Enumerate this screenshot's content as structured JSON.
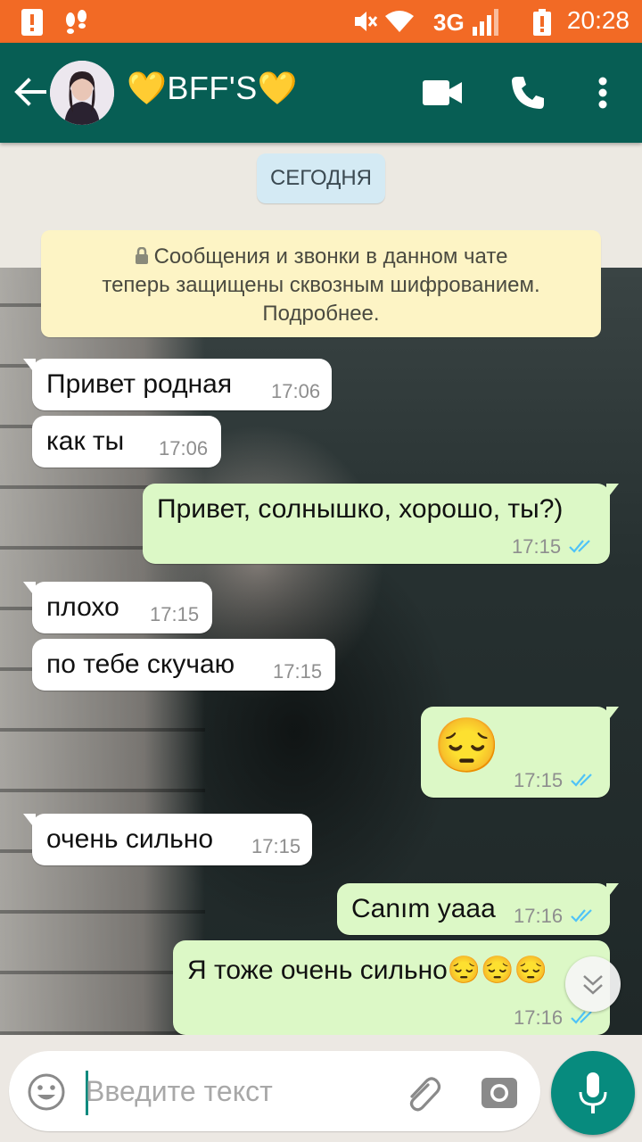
{
  "status_bar": {
    "time": "20:28",
    "network": "3G"
  },
  "header": {
    "title": "💛BFF'S💛"
  },
  "date_chip": "СЕГОДНЯ",
  "encryption_notice": {
    "line1": "Сообщения и звонки в данном чате",
    "line2": "теперь защищены сквозным шифрованием.",
    "line3": "Подробнее."
  },
  "messages": [
    {
      "direction": "in",
      "text": "Привет родная",
      "time": "17:06"
    },
    {
      "direction": "in",
      "text": "как ты",
      "time": "17:06"
    },
    {
      "direction": "out",
      "text": "Привет, солнышко, хорошо, ты?)",
      "time": "17:15",
      "status": "read"
    },
    {
      "direction": "in",
      "text": "плохо",
      "time": "17:15"
    },
    {
      "direction": "in",
      "text": "по тебе скучаю",
      "time": "17:15"
    },
    {
      "direction": "out",
      "text": "😔",
      "time": "17:15",
      "status": "read"
    },
    {
      "direction": "in",
      "text": "очень сильно",
      "time": "17:15"
    },
    {
      "direction": "out",
      "text": "Canım yaaa",
      "time": "17:16",
      "status": "read"
    },
    {
      "direction": "out",
      "text": "Я тоже очень сильно😔😔😔",
      "time": "17:16",
      "status": "read"
    }
  ],
  "input": {
    "placeholder": "Введите текст",
    "value": ""
  },
  "colors": {
    "status_bar": "#f26a25",
    "app_bar": "#075e54",
    "outgoing": "#dcf8c6",
    "read_ticks": "#4fc3f7",
    "mic": "#078b7e"
  }
}
